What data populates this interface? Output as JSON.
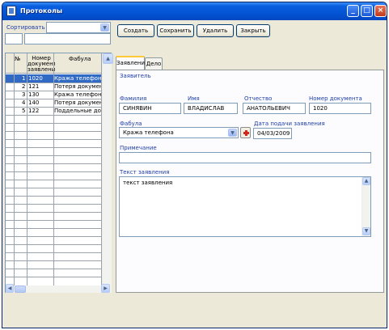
{
  "window": {
    "title": "Протоколы",
    "controls": {
      "minimize": "_",
      "maximize": "□",
      "close": "×"
    }
  },
  "sort": {
    "label": "Сортировать по",
    "value": "",
    "filter_value": ""
  },
  "toolbar": {
    "create_label": "Создать",
    "save_label": "Сохранить",
    "delete_label": "Удалить",
    "close_label": "Закрыть"
  },
  "table": {
    "headers": [
      "№",
      "Номер документа заявления",
      "Фабула"
    ],
    "rows": [
      {
        "num": "1",
        "doc": "1020",
        "fabula": "Кража телефона",
        "selected": true
      },
      {
        "num": "2",
        "doc": "121",
        "fabula": "Потеря документов",
        "selected": false
      },
      {
        "num": "3",
        "doc": "130",
        "fabula": "Кража телефона",
        "selected": false
      },
      {
        "num": "4",
        "doc": "140",
        "fabula": "Потеря документов",
        "selected": false
      },
      {
        "num": "5",
        "doc": "122",
        "fabula": "Поддельные докумен",
        "selected": false
      }
    ],
    "selection_color": "#316ac5"
  },
  "tabs": [
    {
      "label": "Заявление",
      "active": true
    },
    {
      "label": "Дело",
      "active": false
    }
  ],
  "form": {
    "section_label": "Заявитель",
    "surname_label": "Фамилия",
    "surname_value": "СИНЯВИН",
    "name_label": "Имя",
    "name_value": "ВЛАДИСЛАВ",
    "patronymic_label": "Отчество",
    "patronymic_value": "АНАТОЛЬЕВИЧ",
    "docnum_label": "Номер документа",
    "docnum_value": "1020",
    "fabula_label": "Фабула",
    "fabula_value": "Кража телефона",
    "date_label": "Дата подачи заявления",
    "date_value": "04/03/2009",
    "note_label": "Примечание",
    "note_value": "",
    "text_label": "Текст заявления",
    "text_value": "текст заявления"
  },
  "colors": {
    "label_blue": "#1e3ea8",
    "titlebar": "#0354d4",
    "window_bg": "#ece9d8"
  }
}
